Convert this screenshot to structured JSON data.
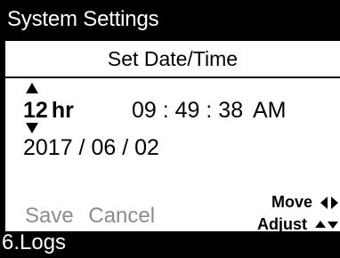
{
  "window": {
    "title": "System Settings"
  },
  "dialog": {
    "title": "Set Date/Time",
    "time_format": {
      "value": "12",
      "unit": "hr"
    },
    "time": {
      "text": "09 : 49 : 38",
      "meridiem": "AM"
    },
    "date": {
      "text": "2017 / 06 / 02"
    },
    "buttons": {
      "save": "Save",
      "cancel": "Cancel"
    },
    "hints": {
      "move": "Move",
      "adjust": "Adjust"
    }
  },
  "background_menu": {
    "partial_item": "6.Logs"
  },
  "colors": {
    "background": "#000000",
    "panel": "#ffffff",
    "disabled_text": "#8c8c8c"
  },
  "icons": {
    "time_format_up": "triangle-up-icon",
    "time_format_down": "triangle-down-icon",
    "move": "left-right-arrows-icon",
    "adjust": "up-down-arrows-icon"
  }
}
